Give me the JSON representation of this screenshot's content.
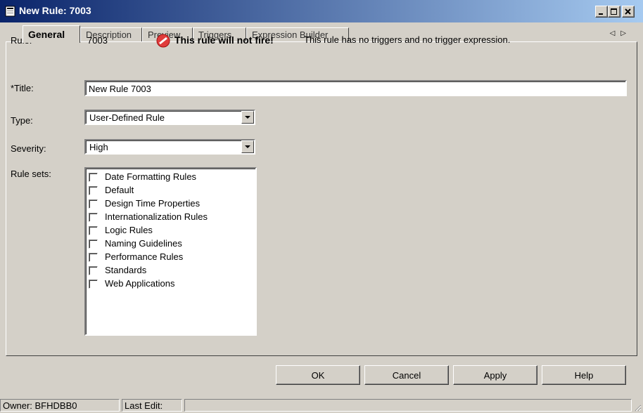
{
  "window": {
    "title": "New Rule: 7003",
    "icon": "app-document-icon"
  },
  "tabs": [
    {
      "label": "General",
      "active": true
    },
    {
      "label": "Description"
    },
    {
      "label": "Preview"
    },
    {
      "label": "Triggers"
    },
    {
      "label": "Expression Builder"
    }
  ],
  "tab_scroll": {
    "left": "◁",
    "right": "▷"
  },
  "form": {
    "rule_label": "Rule:",
    "rule_value": "7003",
    "warning_title": "This rule will not fire!",
    "warning_text": "This rule has no triggers and no trigger expression.",
    "title_label": "*Title:",
    "title_value": "New Rule  7003",
    "type_label": "Type:",
    "type_value": "User-Defined Rule",
    "severity_label": "Severity:",
    "severity_value": "High",
    "rulesets_label": "Rule sets:",
    "rulesets": [
      {
        "label": "Date Formatting Rules",
        "checked": false
      },
      {
        "label": "Default",
        "checked": false
      },
      {
        "label": "Design Time Properties",
        "checked": false
      },
      {
        "label": "Internationalization Rules",
        "checked": false
      },
      {
        "label": "Logic Rules",
        "checked": false
      },
      {
        "label": "Naming Guidelines",
        "checked": false
      },
      {
        "label": "Performance Rules",
        "checked": false
      },
      {
        "label": "Standards",
        "checked": false
      },
      {
        "label": "Web Applications",
        "checked": false
      }
    ]
  },
  "buttons": {
    "ok": "OK",
    "cancel": "Cancel",
    "apply": "Apply",
    "help": "Help"
  },
  "statusbar": {
    "owner": "Owner: BFHDBB0",
    "last_edit": "Last Edit:"
  },
  "colors": {
    "titlebar_start": "#0a246a",
    "titlebar_end": "#a6caf0",
    "face": "#d4d0c8",
    "warning": "#e03c3c"
  }
}
